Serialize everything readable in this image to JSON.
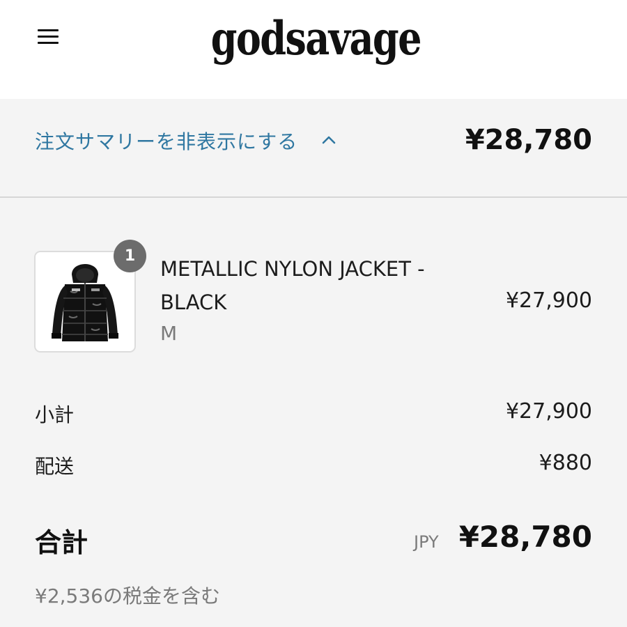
{
  "header": {
    "logo_text": "godsavage",
    "menu_icon": "hamburger-menu-icon"
  },
  "summary_toggle": {
    "label": "注文サマリーを非表示にする",
    "chevron_icon": "chevron-up-icon",
    "total": "¥28,780"
  },
  "line_items": [
    {
      "name": "METALLIC NYLON JACKET - BLACK",
      "variant": "M",
      "quantity": "1",
      "price": "¥27,900",
      "image": "black-puffer-jacket-image"
    }
  ],
  "totals": {
    "subtotal_label": "小計",
    "subtotal_value": "¥27,900",
    "shipping_label": "配送",
    "shipping_value": "¥880",
    "total_label": "合計",
    "currency": "JPY",
    "total_value": "¥28,780",
    "tax_note": "¥2,536の税金を含む"
  },
  "colors": {
    "link": "#2f77a1",
    "background": "#f4f4f4",
    "header_background": "#ffffff",
    "badge": "#6c6c6c"
  }
}
